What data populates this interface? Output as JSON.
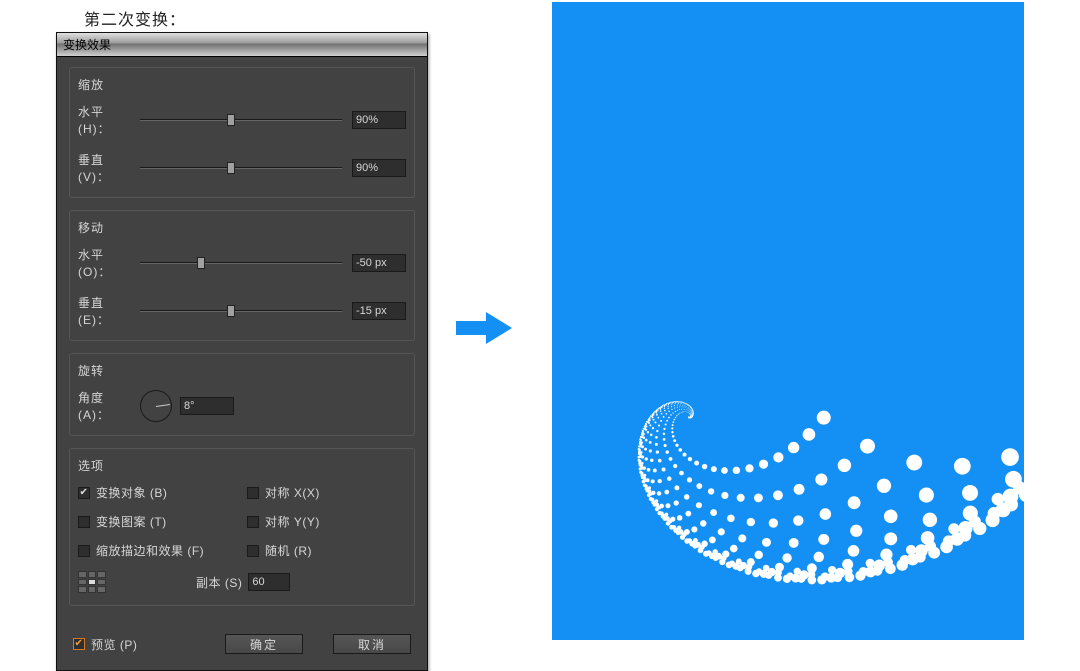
{
  "heading": "第二次变换：",
  "dialog": {
    "title": "变换效果",
    "scale": {
      "legend": "缩放",
      "horizontal_label": "水平 (H)：",
      "horizontal_value": "90%",
      "horizontal_pos": 45,
      "vertical_label": "垂直 (V)：",
      "vertical_value": "90%",
      "vertical_pos": 45
    },
    "move": {
      "legend": "移动",
      "horizontal_label": "水平 (O)：",
      "horizontal_value": "-50 px",
      "horizontal_pos": 30,
      "vertical_label": "垂直 (E)：",
      "vertical_value": "-15 px",
      "vertical_pos": 45
    },
    "rotate": {
      "legend": "旋转",
      "angle_label": "角度 (A)：",
      "angle_value": "8°"
    },
    "options": {
      "legend": "选项",
      "transform_objects": {
        "label": "变换对象 (B)",
        "checked": true
      },
      "transform_patterns": {
        "label": "变换图案 (T)",
        "checked": false
      },
      "scale_strokes": {
        "label": "缩放描边和效果 (F)",
        "checked": false
      },
      "reflect_x": {
        "label": "对称 X(X)",
        "checked": false
      },
      "reflect_y": {
        "label": "对称 Y(Y)",
        "checked": false
      },
      "random": {
        "label": "随机 (R)",
        "checked": false
      },
      "copies_label": "副本 (S)",
      "copies_value": "60"
    },
    "preview": {
      "label": "预览 (P)",
      "checked": true
    },
    "ok": "确定",
    "cancel": "取消"
  },
  "colors": {
    "accent": "#1490f5",
    "panel": "#424242"
  },
  "chart_data": {
    "type": "scatter",
    "title": "Transform effect preview (spiral of dots)",
    "note": "A white dot copied 60 times, each copy scaled 90%, moved (-50,-15) px and rotated 8° relative to the previous, on a blue canvas",
    "series": [],
    "xlim": [
      0,
      472
    ],
    "ylim": [
      0,
      638
    ]
  }
}
